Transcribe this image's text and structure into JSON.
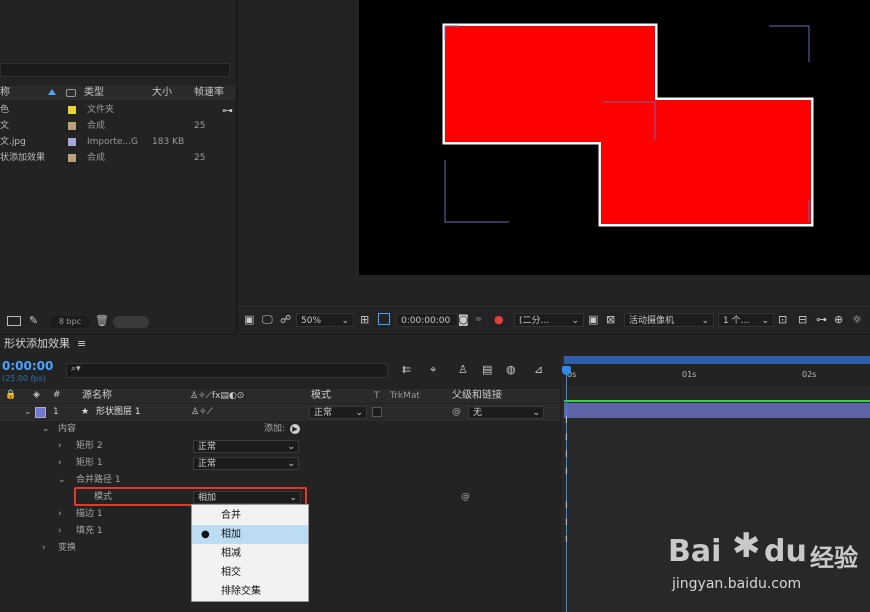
{
  "project": {
    "columns": {
      "type": "类型",
      "size": "大小",
      "fps": "帧速率"
    },
    "header_name_fragment": "称",
    "rows": [
      {
        "name": "色",
        "color": "#e5d23a",
        "type": "文件夹",
        "size": "",
        "fps": ""
      },
      {
        "name": "文",
        "color": "#b8a17a",
        "type": "合成",
        "size": "",
        "fps": "25"
      },
      {
        "name": "文.jpg",
        "color": "#a8a8d8",
        "type": "Importe...G",
        "size": "183 KB",
        "fps": ""
      },
      {
        "name": "状添加效果",
        "color": "#b8a17a",
        "type": "合成",
        "size": "",
        "fps": "25"
      }
    ],
    "bpc": "8 bpc"
  },
  "viewer": {
    "zoom": "50%",
    "timecode": "0:00:00:00",
    "resolution": "(二分…",
    "camera": "活动摄像机",
    "views": "1 个…"
  },
  "timeline": {
    "tab_title": "形状添加效果",
    "menu_icon": "≡",
    "current_time": "0:00:00",
    "fps_label": "(25.00 fps)",
    "columns": {
      "source_name": "源名称",
      "mode": "模式",
      "t": "T",
      "trkmat": "TrkMat",
      "parent": "父级和链接"
    },
    "layer": {
      "index": "1",
      "name": "形状图层 1",
      "mode": "正常",
      "parent": "无"
    },
    "contents": {
      "label": "内容",
      "add_label": "添加:"
    },
    "rect2": {
      "label": "矩形 2",
      "mode": "正常"
    },
    "rect1": {
      "label": "矩形 1",
      "mode": "正常"
    },
    "merge": {
      "label": "合并路径 1"
    },
    "merge_mode": {
      "label": "模式",
      "value": "相加"
    },
    "stroke": {
      "label": "描边 1"
    },
    "fill": {
      "label": "填充 1"
    },
    "transform": {
      "label": "变换"
    },
    "ruler": [
      "0s",
      "01s",
      "02s"
    ]
  },
  "popup": {
    "items": [
      "合并",
      "相加",
      "相减",
      "相交",
      "排除交集"
    ],
    "selected_index": 1
  },
  "watermark": {
    "brand": "Bai",
    "brand2": "du",
    "suffix": "经验",
    "url": "jingyan.baidu.com"
  },
  "colors": {
    "accent": "#2d8ceb",
    "layer_bar": "#5f64a8",
    "shape": "#ff0000",
    "highlight": "#e23a2a"
  }
}
